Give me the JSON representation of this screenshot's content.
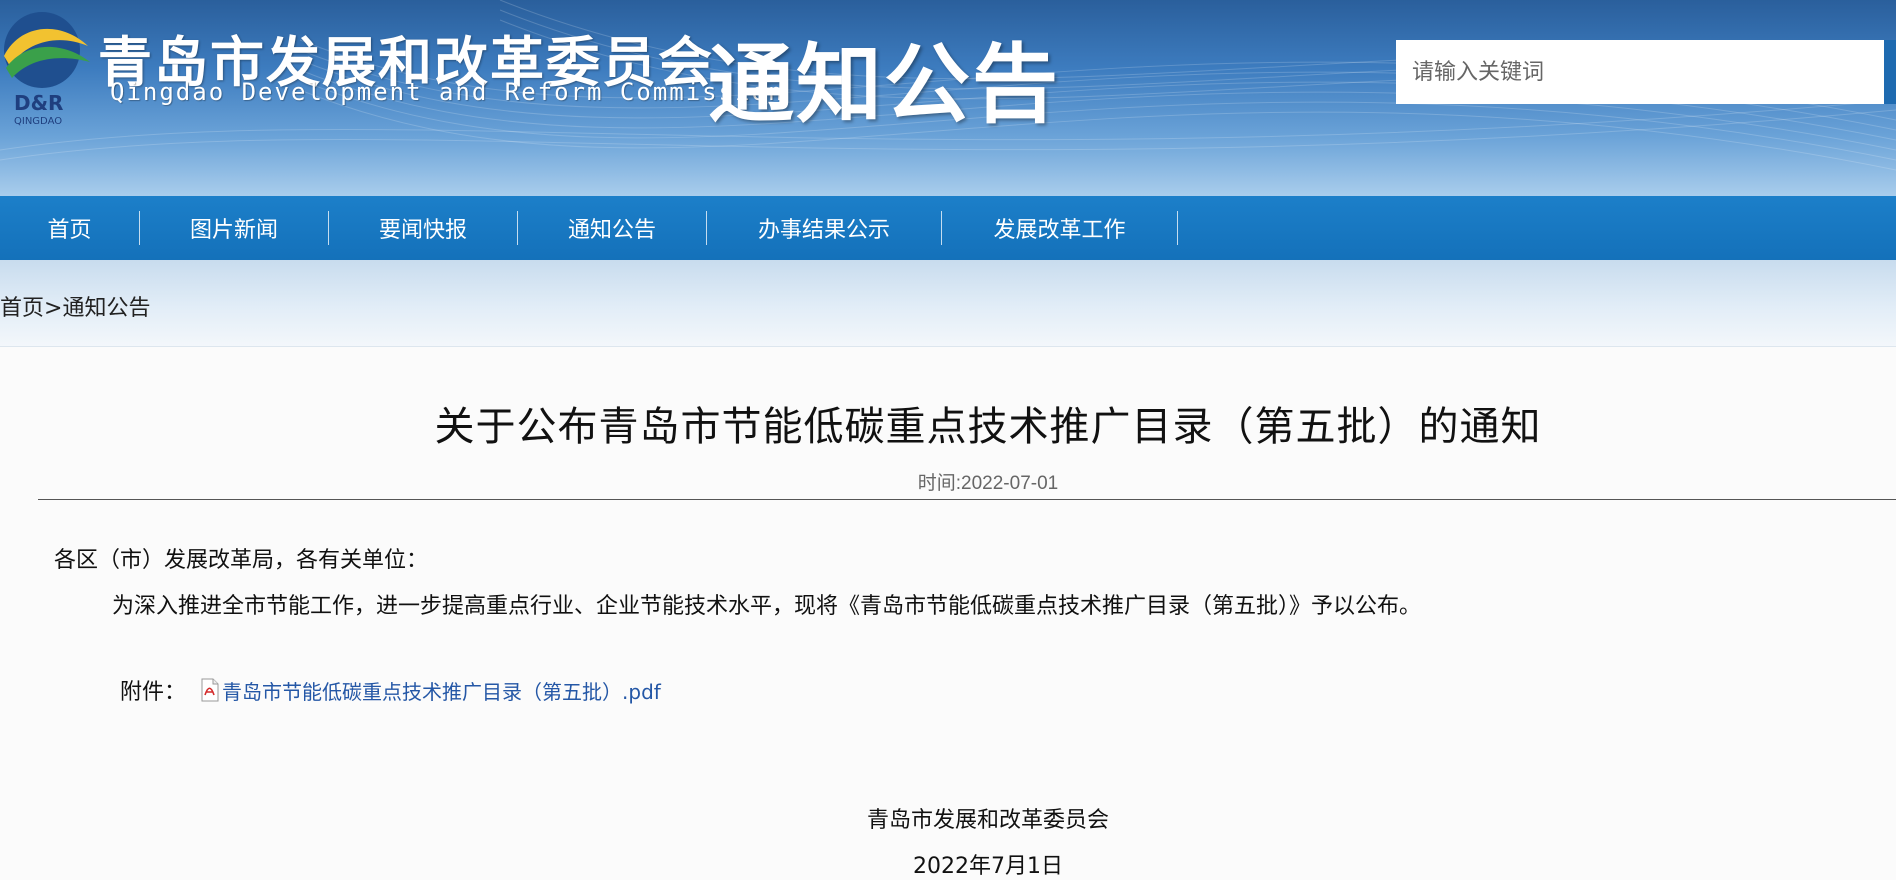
{
  "header": {
    "site_name": "青岛市发展和改革委员会",
    "site_name_en": "Qingdao Development and Reform Commission",
    "logo_text": "D&R",
    "logo_subtext": "QINGDAO",
    "section_title": "通知公告",
    "search": {
      "placeholder": "请输入关键词",
      "value": ""
    }
  },
  "nav": {
    "items": [
      {
        "label": "首页"
      },
      {
        "label": "图片新闻"
      },
      {
        "label": "要闻快报"
      },
      {
        "label": "通知公告"
      },
      {
        "label": "办事结果公示"
      },
      {
        "label": "发展改革工作"
      }
    ]
  },
  "breadcrumb": {
    "home": "首页",
    "separator": ">",
    "current": "通知公告"
  },
  "article": {
    "title": "关于公布青岛市节能低碳重点技术推广目录（第五批）的通知",
    "time": "时间:2022-07-01",
    "salutation": "各区（市）发展改革局，各有关单位：",
    "paragraph": "为深入推进全市节能工作，进一步提高重点行业、企业节能技术水平，现将《青岛市节能低碳重点技术推广目录（第五批）》予以公布。",
    "attachment_label": "附件：",
    "attachment_name": "青岛市节能低碳重点技术推广目录（第五批）.pdf",
    "attachment_icon": "pdf-icon",
    "signature": "青岛市发展和改革委员会",
    "signature_date": "2022年7月1日"
  },
  "colors": {
    "nav_bg": "#1576c0",
    "link": "#2457a6",
    "banner_top": "#2a5f9c"
  }
}
